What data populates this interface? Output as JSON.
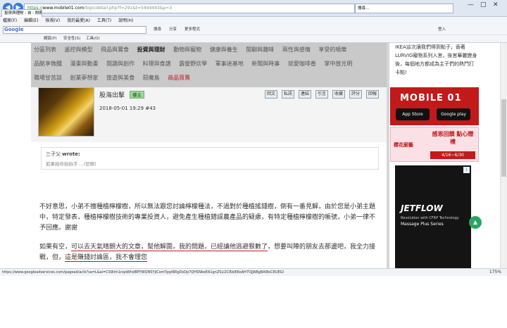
{
  "browser": {
    "address_https": "https://",
    "address_host": "www.mobile01.com",
    "address_path": "/topicdetail.php?f=291&t=5444443&p=3",
    "tab_title": "投資與理財 - 自 - 財務養",
    "second_tab": "搜尋...",
    "menu": [
      "檔案(F)",
      "編輯(E)",
      "檢視(V)",
      "我的最愛(A)",
      "工具(T)",
      "說明(H)"
    ],
    "google_label": "Google",
    "toolbar_items": [
      "搜尋",
      "分享",
      "更多程式",
      "登入"
    ],
    "fav_items": [
      "網頁(P)",
      "安全性(S)",
      "工具(O)"
    ],
    "status_url": "https://www.googleadservices.com/pagead/aclk?sa=L&ai=CS9llm1nqsWhdBPYWQN5YjlCsmTpqtRRgDsDp7QHSNkeEA1gnZSLl2CRbiE6oAH7OjJABgBAl8sCRUEGl",
    "zoom_label": "175%"
  },
  "board_menu": {
    "row1": [
      "分區列表",
      "遙控與模型",
      "飛品與實食",
      "投資與理財",
      "動物與寵物",
      "健康與養生",
      "閒聊與趣味",
      "兩性與感情",
      "享受的噴樂"
    ],
    "row2": [
      "品酩享微醺",
      "漫畫與動畫",
      "閱讀與創作",
      "料理與食譜",
      "露營野炊學",
      "軍事迷基地",
      "新聞與時事",
      "就愛咖啡香",
      "掌中放光明"
    ],
    "row3": [
      "職場甘苦談",
      "創業夢想家",
      "旅遊與美食",
      "惡魔島",
      "商品買賣"
    ],
    "active": "投資與理財",
    "red": "商品買賣"
  },
  "post": {
    "author": "股海出擊",
    "rank": "樓主",
    "date": "2018-05-01 19:29",
    "floor": "#43",
    "actions": [
      "回文",
      "私訊",
      "連結",
      "引言",
      "收藏",
      "評分",
      "回報"
    ],
    "quote_user": "三子父",
    "quote_wrote": "wrote:",
    "quote_text": "如果給你拍拍手 ...(恕刪)",
    "para1": "不好意思，小弟不擅種植檸檬樹，所以無法跟您討論檸檬種法，不過對於種植搖錢樹，倒有一番見解，由於您是小弟主題中，特定發表，種植檸檬樹技術的專業投資人，避免產生種植錯誤農產品的疑慮，有特定種植檸檬樹的帳號，小弟一律不予回應。謝謝",
    "para2_a": "如果有空，",
    "para2_hl1": "可以去天氣晴朗大的文章，幫他解圍，我的問題，已經讓他逃避狠數了",
    "para2_b": "，想要叫陣的朋友去那邊吧，我全力接戰，但，",
    "para2_hl2": "這是賺錢討論區，我不會理您"
  },
  "sidebar": {
    "ikea_text": "IKEA這次讓我們得到點子，香著LURVIG寵物系列入宮，後宮華麗變身後，每個地方都成為主子們的熱門打卡點!",
    "mobile01_logo": "MOBILE 01",
    "app_store": "App Store",
    "google_play": "Google play",
    "sakura_name": "櫻花廚藝",
    "sakura_promo": "感恩回饋 點心贈禮",
    "sakura_date": "4/16~6/30",
    "jetflow_name": "JETFLOW",
    "jetflow_sub": "Revolution with CFRP Technology",
    "jetflow_sub2": "Massage Plus Series",
    "ad_badge": "i"
  }
}
